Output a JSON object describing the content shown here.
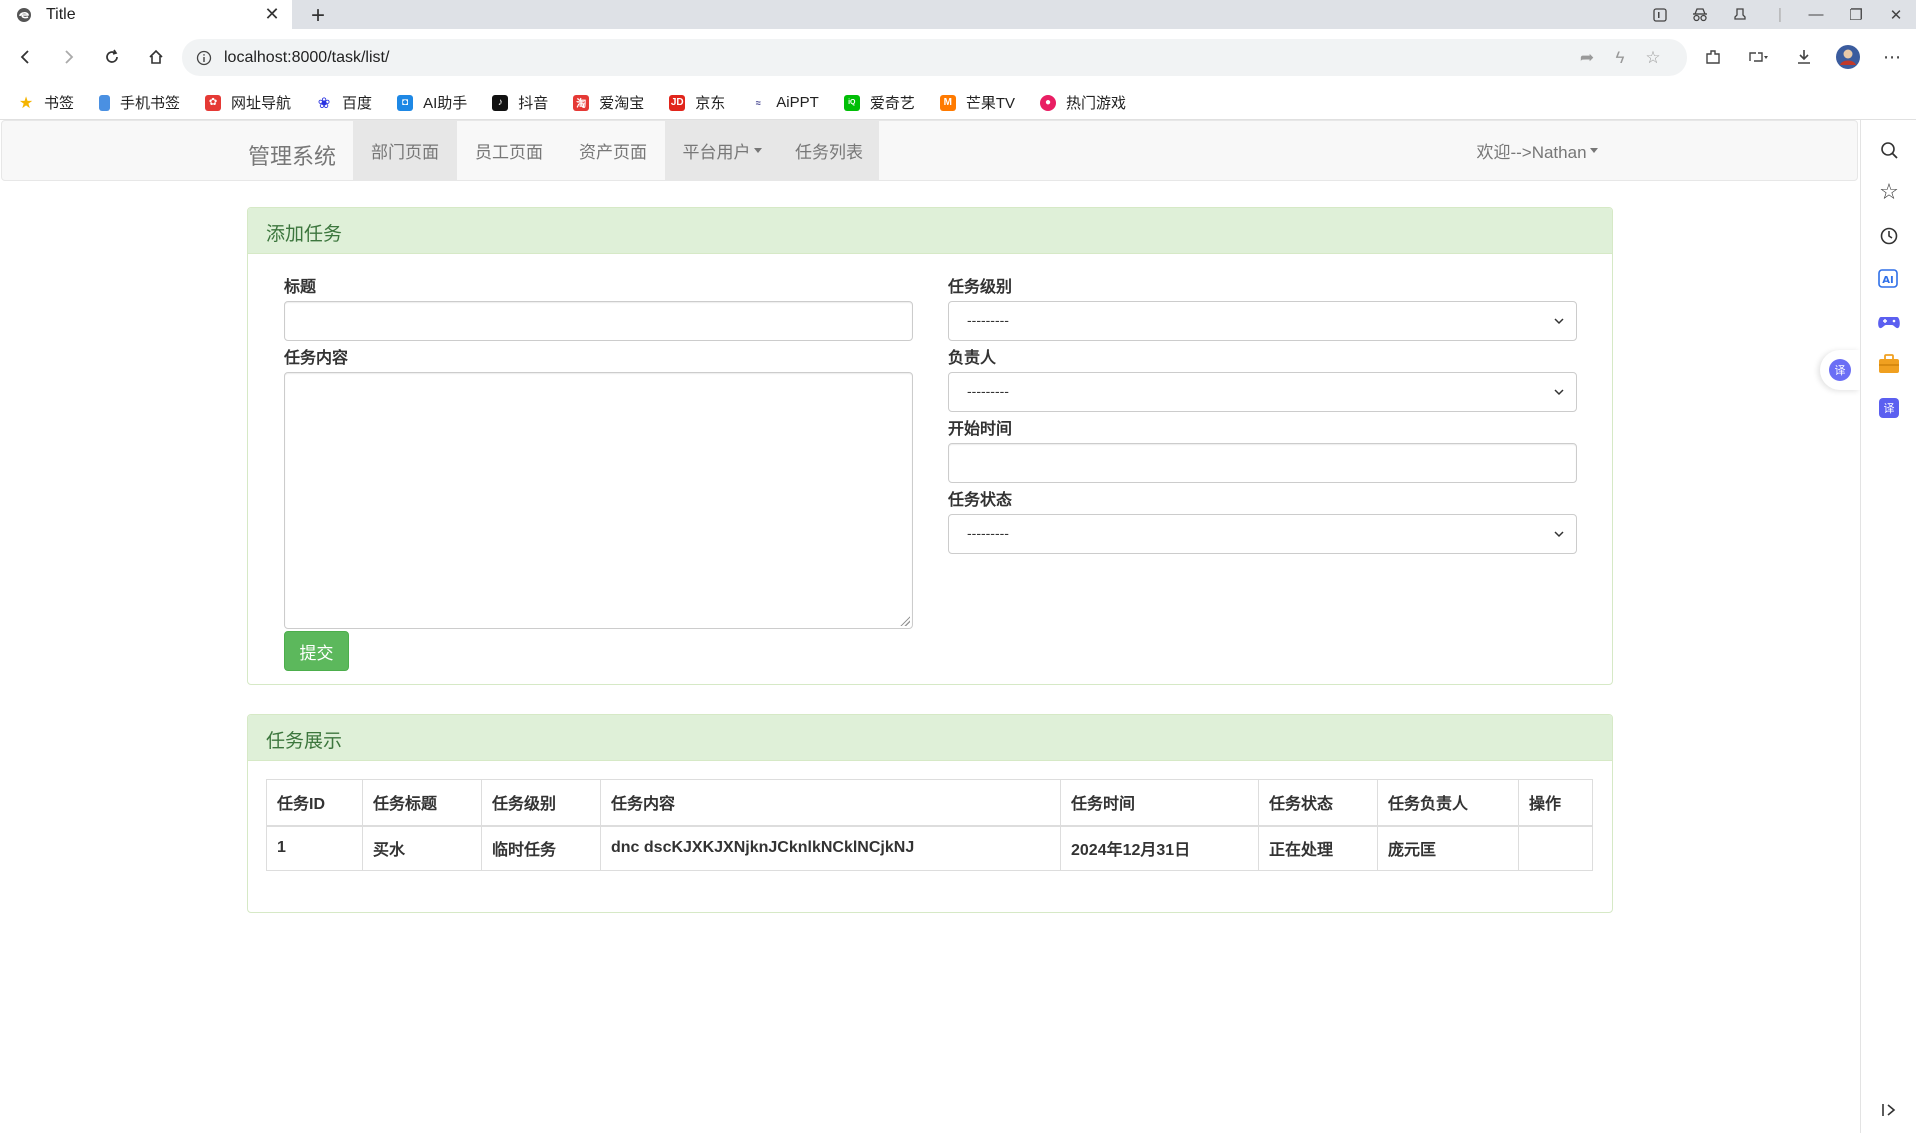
{
  "browser": {
    "tab_title": "Title",
    "url": "localhost:8000/task/list/",
    "bookmarks": [
      {
        "label": "书签",
        "icon": "star-icon",
        "color": "#f5b400"
      },
      {
        "label": "手机书签",
        "icon": "phone-icon",
        "color": "#4a90e2"
      },
      {
        "label": "网址导航",
        "icon": "navigation-icon",
        "color": "#e53935"
      },
      {
        "label": "百度",
        "icon": "baidu-icon",
        "color": "#2932e1"
      },
      {
        "label": "AI助手",
        "icon": "ai-assistant-icon",
        "color": "#1e88e5"
      },
      {
        "label": "抖音",
        "icon": "douyin-icon",
        "color": "#111111"
      },
      {
        "label": "爱淘宝",
        "icon": "taobao-icon",
        "color": "#e53935"
      },
      {
        "label": "京东",
        "icon": "jd-icon",
        "color": "#e1251b"
      },
      {
        "label": "AiPPT",
        "icon": "aippt-icon",
        "color": "#3a3a8a"
      },
      {
        "label": "爱奇艺",
        "icon": "iqiyi-icon",
        "color": "#00be06"
      },
      {
        "label": "芒果TV",
        "icon": "mango-tv-icon",
        "color": "#ff7a00"
      },
      {
        "label": "热门游戏",
        "icon": "games-icon",
        "color": "#e91e63"
      }
    ]
  },
  "navbar": {
    "brand": "管理系统",
    "links": [
      {
        "label": "部门页面"
      },
      {
        "label": "员工页面"
      },
      {
        "label": "资产页面"
      },
      {
        "label": "平台用户"
      },
      {
        "label": "任务列表"
      }
    ],
    "user": "欢迎-->Nathan"
  },
  "add_task": {
    "heading": "添加任务",
    "fields": {
      "title": {
        "label": "标题",
        "value": ""
      },
      "content": {
        "label": "任务内容",
        "value": ""
      },
      "level": {
        "label": "任务级别",
        "value": "---------"
      },
      "owner": {
        "label": "负责人",
        "value": "---------"
      },
      "start_time": {
        "label": "开始时间",
        "value": ""
      },
      "status": {
        "label": "任务状态",
        "value": "---------"
      }
    },
    "submit_label": "提交"
  },
  "task_list": {
    "heading": "任务展示",
    "columns": [
      "任务ID",
      "任务标题",
      "任务级别",
      "任务内容",
      "任务时间",
      "任务状态",
      "任务负责人",
      "操作"
    ],
    "rows": [
      [
        "1",
        "买水",
        "临时任务",
        "dnc dscKJXKJXNjknJCknlkNCklNCjkNJ",
        "2024年12月31日",
        "正在处理",
        "庞元匡",
        ""
      ]
    ]
  },
  "colors": {
    "panel_heading_bg": "#dff0d8",
    "panel_heading_text": "#3c763d",
    "submit_button": "#5cb85c"
  }
}
